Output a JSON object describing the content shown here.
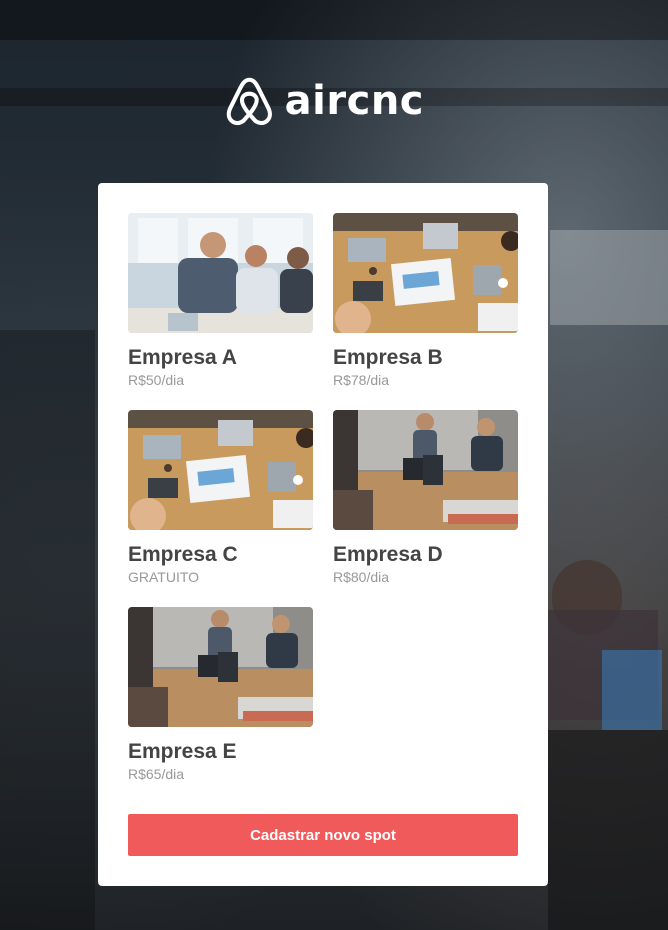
{
  "brand": {
    "name": "aircnc",
    "logo_icon": "airbnb-belo-icon"
  },
  "spots": [
    {
      "name": "Empresa A",
      "price": "R$50/dia",
      "image": "meeting-photo-three-people"
    },
    {
      "name": "Empresa B",
      "price": "R$78/dia",
      "image": "meeting-photo-table-overhead"
    },
    {
      "name": "Empresa C",
      "price": "GRATUITO",
      "image": "meeting-photo-table-overhead"
    },
    {
      "name": "Empresa D",
      "price": "R$80/dia",
      "image": "meeting-photo-presentation"
    },
    {
      "name": "Empresa E",
      "price": "R$65/dia",
      "image": "meeting-photo-presentation"
    }
  ],
  "actions": {
    "new_spot_label": "Cadastrar novo spot"
  },
  "colors": {
    "accent": "#f05a5b",
    "title_text": "#444444",
    "price_text": "#999999"
  }
}
